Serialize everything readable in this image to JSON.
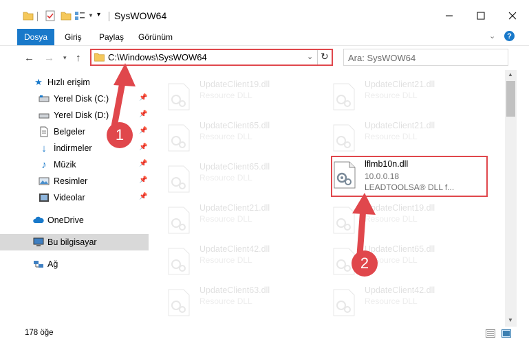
{
  "window": {
    "title": "SysWOW64",
    "minimize_glyph": "—",
    "maximize_glyph": "☐",
    "close_glyph": "✕"
  },
  "ribbon": {
    "tabs": [
      "Dosya",
      "Giriş",
      "Paylaş",
      "Görünüm"
    ],
    "help_glyph": "?"
  },
  "nav": {
    "address": "C:\\Windows\\SysWOW64",
    "search_placeholder": "Ara: SysWOW64"
  },
  "sidebar": {
    "items": [
      {
        "label": "Hızlı erişim",
        "icon": "star-icon",
        "pinned": false
      },
      {
        "label": "Yerel Disk (C:)",
        "icon": "drive-icon",
        "pinned": true
      },
      {
        "label": "Yerel Disk (D:)",
        "icon": "drive-icon",
        "pinned": true
      },
      {
        "label": "Belgeler",
        "icon": "document-icon",
        "pinned": true
      },
      {
        "label": "İndirmeler",
        "icon": "download-icon",
        "pinned": true
      },
      {
        "label": "Müzik",
        "icon": "music-icon",
        "pinned": true
      },
      {
        "label": "Resimler",
        "icon": "pictures-icon",
        "pinned": true
      },
      {
        "label": "Videolar",
        "icon": "video-icon",
        "pinned": true
      },
      {
        "label": "OneDrive",
        "icon": "cloud-icon",
        "pinned": false
      },
      {
        "label": "Bu bilgisayar",
        "icon": "computer-icon",
        "pinned": false,
        "selected": true
      },
      {
        "label": "Ağ",
        "icon": "network-icon",
        "pinned": false
      }
    ]
  },
  "files": [
    {
      "name": "UpdateClient19.dll",
      "type": "Resource DLL",
      "faded": true
    },
    {
      "name": "UpdateClient21.dll",
      "type": "Resource DLL",
      "faded": true
    },
    {
      "name": "UpdateClient65.dll",
      "type": "Resource DLL",
      "faded": true
    },
    {
      "name": "UpdateClient21.dll",
      "type": "Resource DLL",
      "faded": true
    },
    {
      "name": "UpdateClient65.dll",
      "type": "Resource DLL",
      "faded": true
    },
    {
      "name": "lflmb10n.dll",
      "type": "10.0.0.18",
      "extra": "LEADTOOLSA® DLL f...",
      "faded": false
    },
    {
      "name": "UpdateClient21.dll",
      "type": "Resource DLL",
      "faded": true
    },
    {
      "name": "UpdateClient19.dll",
      "type": "Resource DLL",
      "faded": true
    },
    {
      "name": "UpdateClient42.dll",
      "type": "Resource DLL",
      "faded": true
    },
    {
      "name": "UpdateClient65.dll",
      "type": "Resource DLL",
      "faded": true
    },
    {
      "name": "UpdateClient63.dll",
      "type": "Resource DLL",
      "faded": true
    },
    {
      "name": "UpdateClient42.dll",
      "type": "Resource DLL",
      "faded": true
    }
  ],
  "status": {
    "count": "178 öğe"
  },
  "annotations": {
    "step1": "1",
    "step2": "2",
    "color": "#e0474c"
  }
}
